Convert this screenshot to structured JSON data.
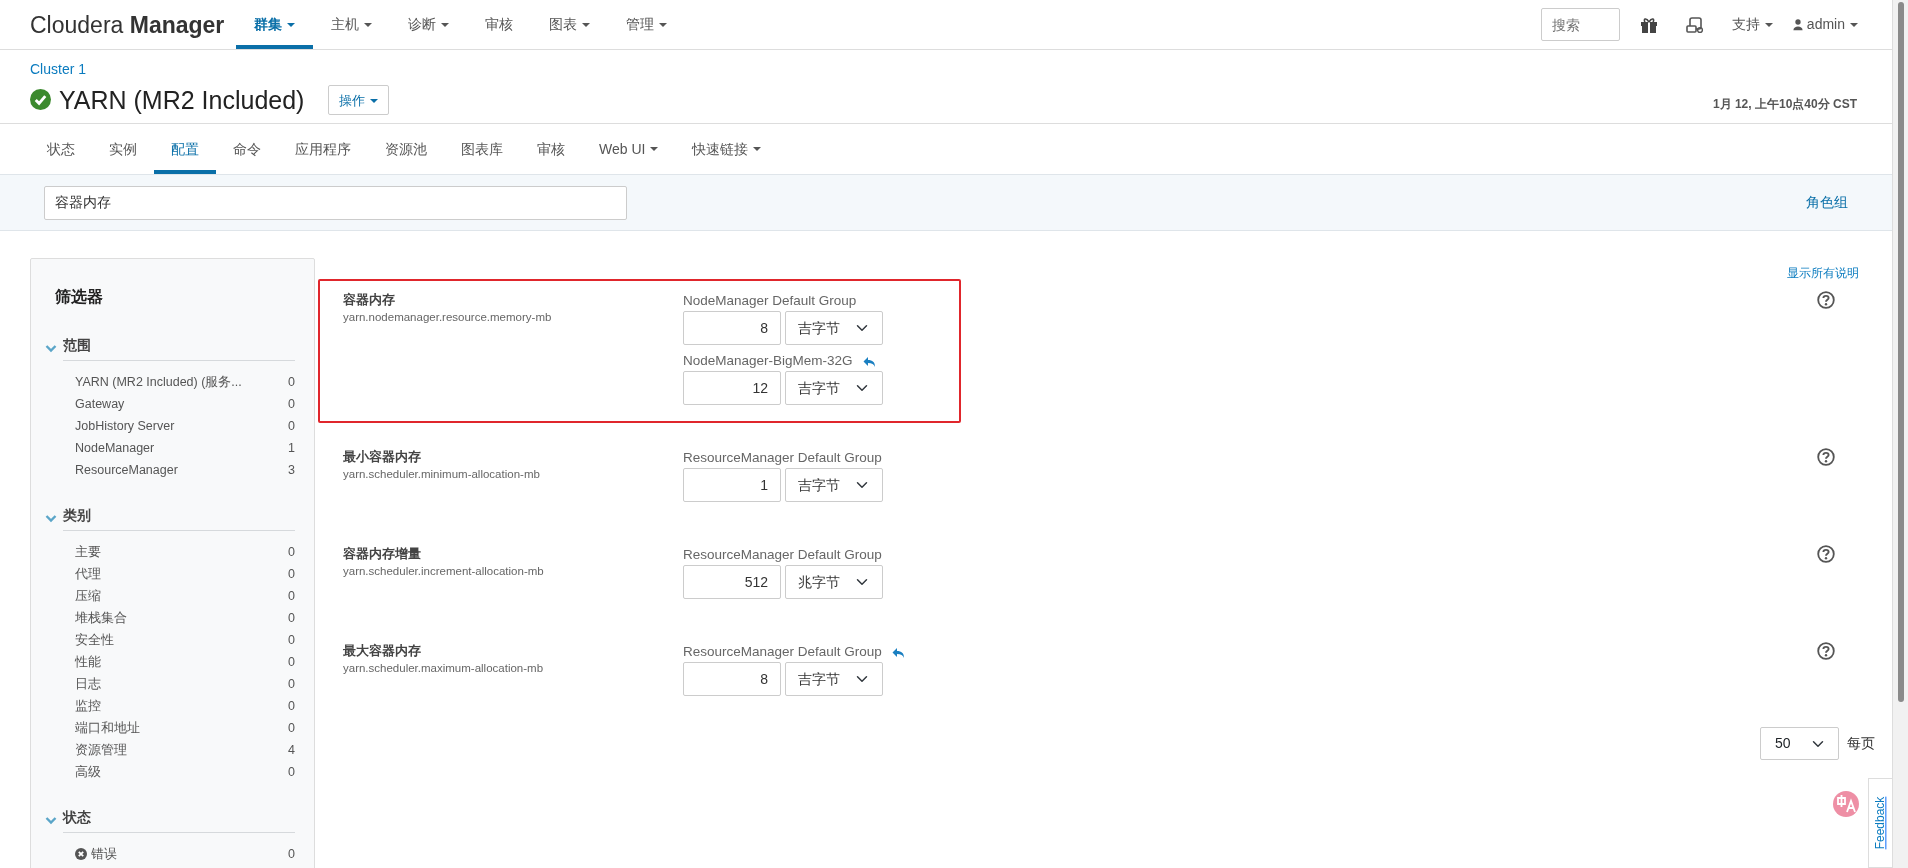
{
  "navbar": {
    "brand_light": "Cloudera",
    "brand_bold": "Manager",
    "items": [
      {
        "label": "群集",
        "dropdown": true,
        "selected": true
      },
      {
        "label": "主机",
        "dropdown": true,
        "selected": false
      },
      {
        "label": "诊断",
        "dropdown": true,
        "selected": false
      },
      {
        "label": "审核",
        "dropdown": false,
        "selected": false
      },
      {
        "label": "图表",
        "dropdown": true,
        "selected": false
      },
      {
        "label": "管理",
        "dropdown": true,
        "selected": false
      }
    ],
    "search": {
      "placeholder": "搜索"
    },
    "support": "支持",
    "user": "admin"
  },
  "header": {
    "breadcrumb": "Cluster 1",
    "title": "YARN (MR2 Included)",
    "actions_button": "操作",
    "timestamp": "1月 12, 上午10点40分 CST"
  },
  "tabs": [
    {
      "label": "状态",
      "dropdown": false,
      "selected": false
    },
    {
      "label": "实例",
      "dropdown": false,
      "selected": false
    },
    {
      "label": "配置",
      "dropdown": false,
      "selected": true
    },
    {
      "label": "命令",
      "dropdown": false,
      "selected": false
    },
    {
      "label": "应用程序",
      "dropdown": false,
      "selected": false
    },
    {
      "label": "资源池",
      "dropdown": false,
      "selected": false
    },
    {
      "label": "图表库",
      "dropdown": false,
      "selected": false
    },
    {
      "label": "审核",
      "dropdown": false,
      "selected": false
    },
    {
      "label": "Web UI",
      "dropdown": true,
      "selected": false
    },
    {
      "label": "快速链接",
      "dropdown": true,
      "selected": false
    }
  ],
  "config_search": {
    "value": "容器内存",
    "role_groups_link": "角色组"
  },
  "filters": {
    "title": "筛选器",
    "sections": [
      {
        "title": "范围",
        "expanded": true,
        "items": [
          {
            "label": "YARN (MR2 Included) (服务...",
            "count": "0"
          },
          {
            "label": "Gateway",
            "count": "0"
          },
          {
            "label": "JobHistory Server",
            "count": "0"
          },
          {
            "label": "NodeManager",
            "count": "1"
          },
          {
            "label": "ResourceManager",
            "count": "3"
          }
        ]
      },
      {
        "title": "类别",
        "expanded": true,
        "items": [
          {
            "label": "主要",
            "count": "0"
          },
          {
            "label": "代理",
            "count": "0"
          },
          {
            "label": "压缩",
            "count": "0"
          },
          {
            "label": "堆栈集合",
            "count": "0"
          },
          {
            "label": "安全性",
            "count": "0"
          },
          {
            "label": "性能",
            "count": "0"
          },
          {
            "label": "日志",
            "count": "0"
          },
          {
            "label": "监控",
            "count": "0"
          },
          {
            "label": "端口和地址",
            "count": "0"
          },
          {
            "label": "资源管理",
            "count": "4"
          },
          {
            "label": "高级",
            "count": "0"
          }
        ]
      },
      {
        "title": "状态",
        "expanded": true,
        "items": [
          {
            "label": "错误",
            "count": "0",
            "kind": "error"
          }
        ]
      }
    ]
  },
  "show_all_descriptions": "显示所有说明",
  "settings": [
    {
      "label": "容器内存",
      "property": "yarn.nodemanager.resource.memory-mb",
      "highlighted": true,
      "groups": [
        {
          "name": "NodeManager Default Group",
          "overridden": false,
          "value": "8",
          "unit": "吉字节"
        },
        {
          "name": "NodeManager-BigMem-32G",
          "overridden": true,
          "value": "12",
          "unit": "吉字节"
        }
      ]
    },
    {
      "label": "最小容器内存",
      "property": "yarn.scheduler.minimum-allocation-mb",
      "highlighted": false,
      "groups": [
        {
          "name": "ResourceManager Default Group",
          "overridden": false,
          "value": "1",
          "unit": "吉字节"
        }
      ]
    },
    {
      "label": "容器内存增量",
      "property": "yarn.scheduler.increment-allocation-mb",
      "highlighted": false,
      "groups": [
        {
          "name": "ResourceManager Default Group",
          "overridden": false,
          "value": "512",
          "unit": "兆字节"
        }
      ]
    },
    {
      "label": "最大容器内存",
      "property": "yarn.scheduler.maximum-allocation-mb",
      "highlighted": false,
      "groups": [
        {
          "name": "ResourceManager Default Group",
          "overridden": true,
          "value": "8",
          "unit": "吉字节"
        }
      ]
    }
  ],
  "pagination": {
    "per_page": "50",
    "per_page_label": "每页"
  },
  "feedback": {
    "label": "Feedback"
  }
}
